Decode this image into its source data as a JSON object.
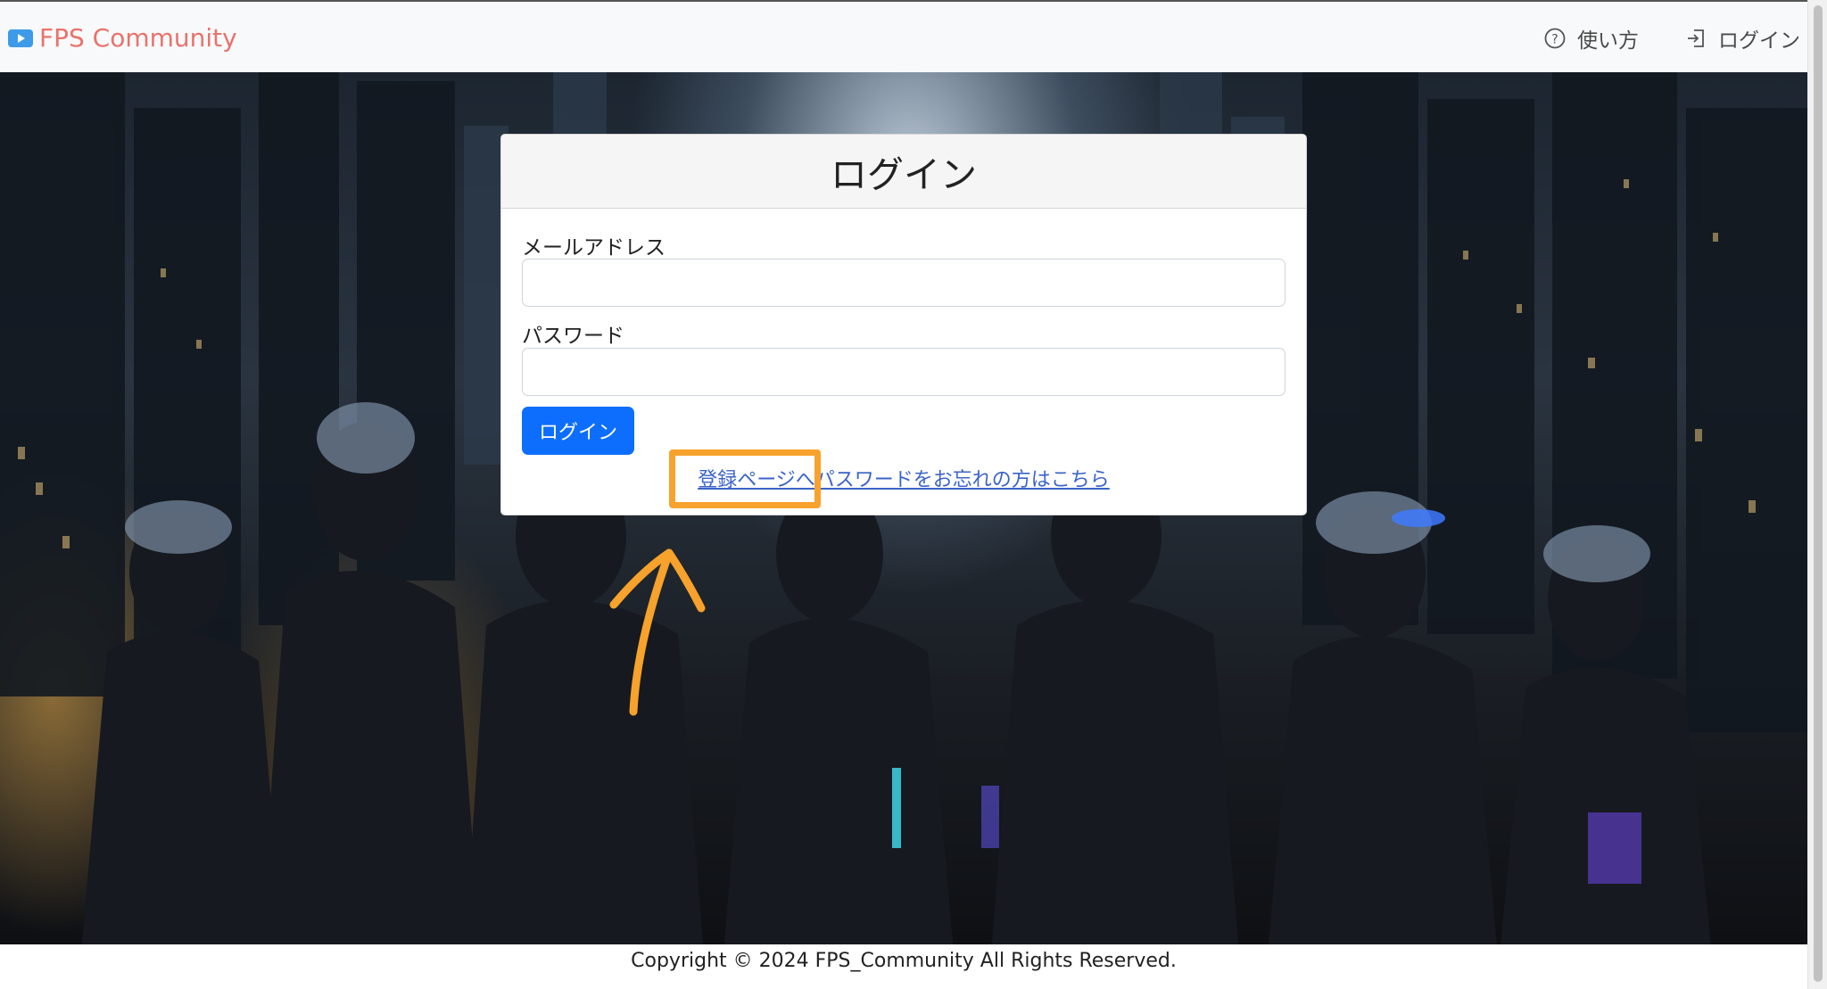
{
  "navbar": {
    "brand": "FPS Community",
    "help_label": "使い方",
    "login_label": "ログイン"
  },
  "login_card": {
    "title": "ログイン",
    "email_label": "メールアドレス",
    "password_label": "パスワード",
    "email_value": "",
    "password_value": "",
    "submit_label": "ログイン",
    "register_link": "登録ページへ",
    "forgot_link": "パスワードをお忘れの方はこちら"
  },
  "footer": {
    "copyright": "Copyright © 2024 FPS_Community All Rights Reserved."
  },
  "colors": {
    "brand": "#e8736c",
    "primary_button": "#0d6efd",
    "link": "#3b63c9",
    "annotation": "#f7a22c"
  },
  "icons": {
    "brand": "play-badge-icon",
    "help": "question-circle-icon",
    "login": "sign-in-icon"
  }
}
